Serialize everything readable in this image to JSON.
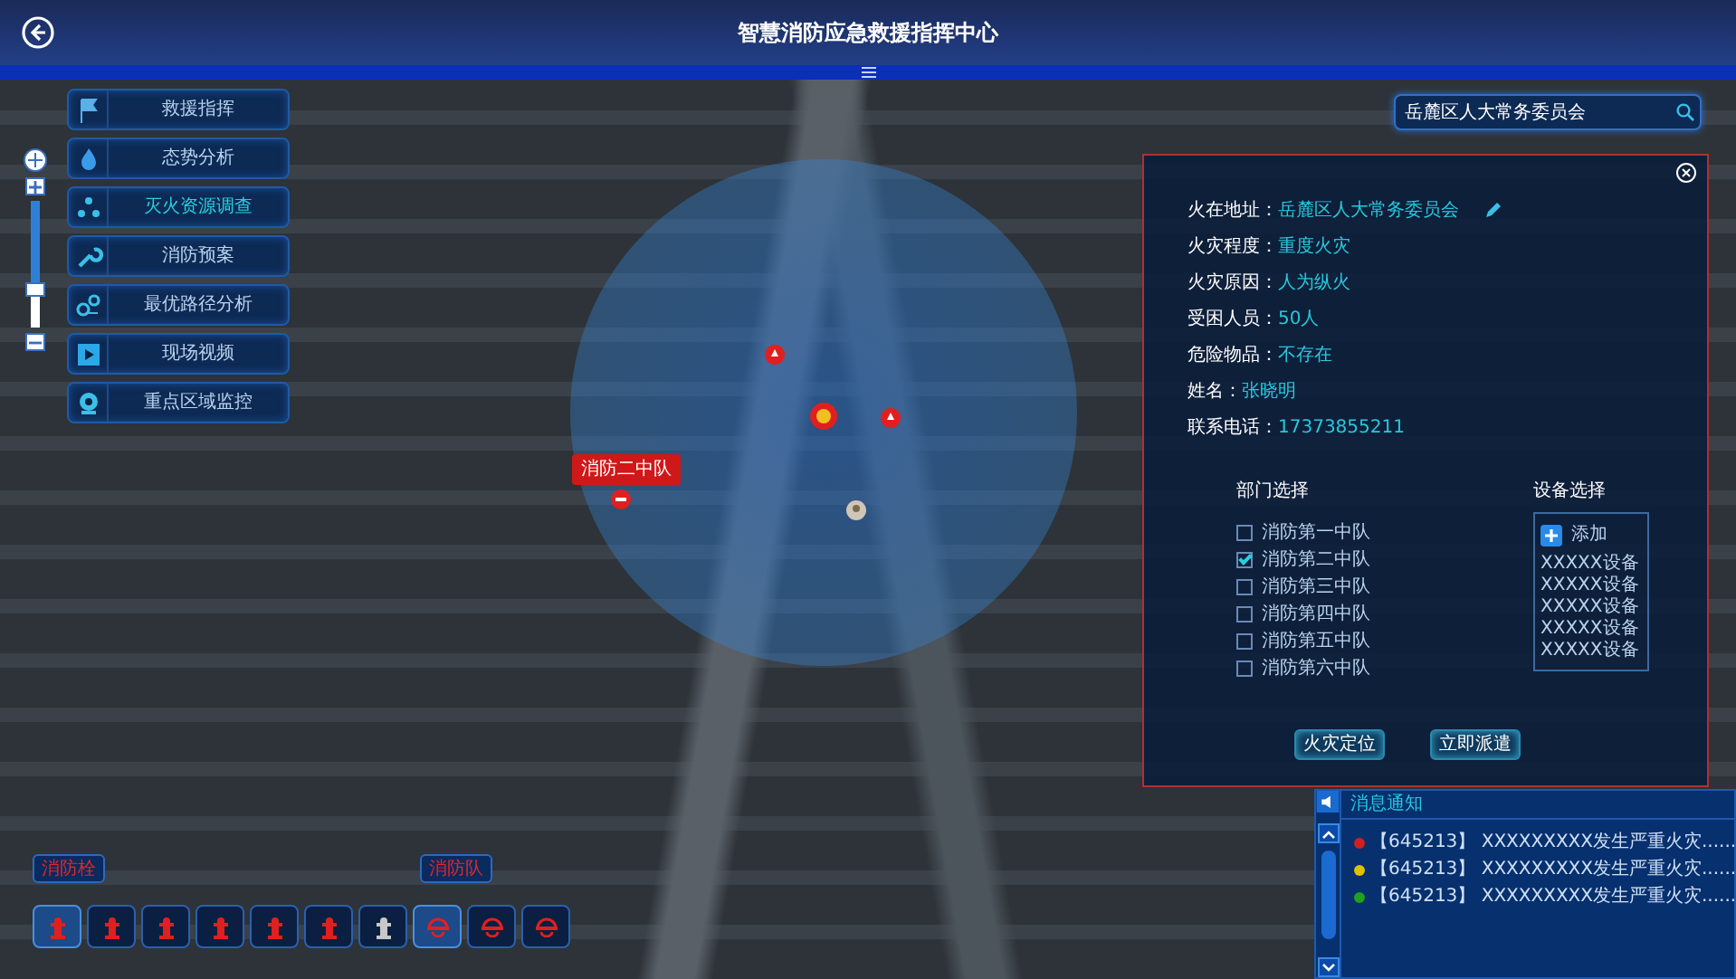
{
  "header": {
    "title": "智慧消防应急救援指挥中心"
  },
  "menu": [
    {
      "label": "救援指挥",
      "selected": false
    },
    {
      "label": "态势分析",
      "selected": false
    },
    {
      "label": "灭火资源调查",
      "selected": true
    },
    {
      "label": "消防预案",
      "selected": false
    },
    {
      "label": "最优路径分析",
      "selected": false
    },
    {
      "label": "现场视频",
      "selected": false
    },
    {
      "label": "重点区域监控",
      "selected": false
    }
  ],
  "zoom": {
    "level": 0.7
  },
  "search": {
    "value": "岳麓区人大常务委员会"
  },
  "map_marker": {
    "label": "消防二中队"
  },
  "info": {
    "fields": [
      {
        "label": "火在地址：",
        "value": "岳麓区人大常务委员会",
        "editable": true
      },
      {
        "label": "火灾程度：",
        "value": "重度火灾",
        "editable": false
      },
      {
        "label": "火灾原因：",
        "value": "人为纵火",
        "editable": false
      },
      {
        "label": "受困人员：",
        "value": "50人",
        "editable": false
      },
      {
        "label": "危险物品：",
        "value": "不存在",
        "editable": false
      },
      {
        "label": "姓名：",
        "value": "张晓明",
        "editable": false
      },
      {
        "label": "联系电话：",
        "value": "17373855211",
        "editable": false
      }
    ],
    "departments": {
      "title": "部门选择",
      "items": [
        {
          "label": "消防第一中队",
          "checked": false
        },
        {
          "label": "消防第二中队",
          "checked": true
        },
        {
          "label": "消防第三中队",
          "checked": false
        },
        {
          "label": "消防第四中队",
          "checked": false
        },
        {
          "label": "消防第五中队",
          "checked": false
        },
        {
          "label": "消防第六中队",
          "checked": false
        }
      ]
    },
    "devices": {
      "title": "设备选择",
      "add_label": "添加",
      "items": [
        "XXXXX设备",
        "XXXXX设备",
        "XXXXX设备",
        "XXXXX设备",
        "XXXXX设备"
      ]
    },
    "buttons": [
      "火灾定位",
      "立即派遣"
    ]
  },
  "layer_tags": [
    "消防栓",
    "消防队"
  ],
  "toolbar": [
    {
      "kind": "hydrant",
      "color": "#e02020",
      "selected": true
    },
    {
      "kind": "hydrant",
      "color": "#e02020",
      "selected": false
    },
    {
      "kind": "hydrant",
      "color": "#e02020",
      "selected": false
    },
    {
      "kind": "hydrant",
      "color": "#e02020",
      "selected": false
    },
    {
      "kind": "hydrant",
      "color": "#e02020",
      "selected": false
    },
    {
      "kind": "hydrant",
      "color": "#e02020",
      "selected": false
    },
    {
      "kind": "hydrant",
      "color": "#c8c8c8",
      "selected": false
    },
    {
      "kind": "station",
      "color": "#e02020",
      "selected": true
    },
    {
      "kind": "station",
      "color": "#e02020",
      "selected": false
    },
    {
      "kind": "station",
      "color": "#e02020",
      "selected": false
    }
  ],
  "notifications": {
    "title": "消息通知",
    "items": [
      {
        "text": "【645213】 XXXXXXXXX发生严重火灾......",
        "color": "#d02020"
      },
      {
        "text": "【645213】 XXXXXXXXX发生严重火灾......",
        "color": "#e0c000"
      },
      {
        "text": "【645213】 XXXXXXXXX发生严重火灾......",
        "color": "#20a020"
      }
    ]
  }
}
